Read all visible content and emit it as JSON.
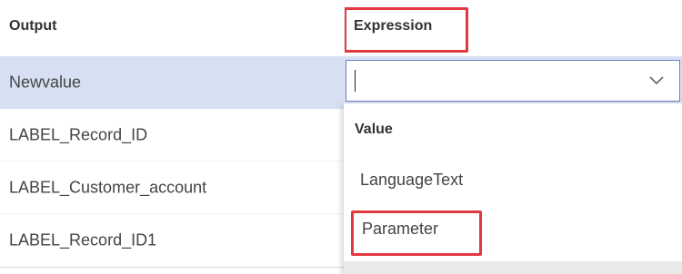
{
  "columns": {
    "output": "Output",
    "expression": "Expression"
  },
  "rows": [
    {
      "label": "Newvalue"
    },
    {
      "label": "LABEL_Record_ID"
    },
    {
      "label": "LABEL_Customer_account"
    },
    {
      "label": "LABEL_Record_ID1"
    }
  ],
  "expression_field": {
    "value": ""
  },
  "dropdown": {
    "header": "Value",
    "options": [
      "LanguageText",
      "Parameter"
    ]
  },
  "colors": {
    "highlight_border": "#e2383f",
    "selected_row": "#d7e0f3",
    "focus_border": "#6d7fbf"
  }
}
